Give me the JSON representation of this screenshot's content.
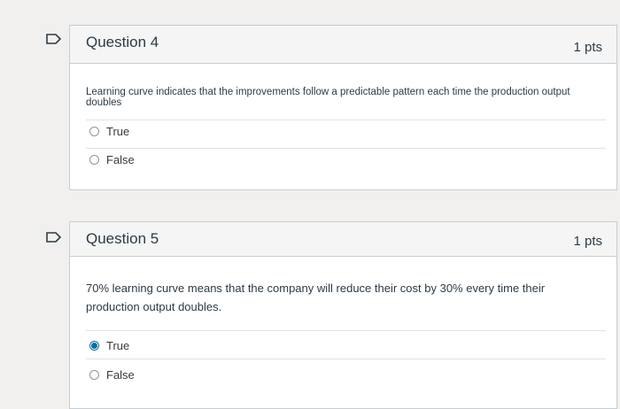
{
  "questions": [
    {
      "title": "Question 4",
      "points": "1 pts",
      "text": "Learning curve indicates that the improvements follow a predictable pattern each time the production output doubles",
      "answers": [
        {
          "label": "True",
          "selected": false
        },
        {
          "label": "False",
          "selected": false
        }
      ]
    },
    {
      "title": "Question 5",
      "points": "1 pts",
      "text": "70% learning curve means that the company will reduce their cost by 30% every time their production output doubles.",
      "answers": [
        {
          "label": "True",
          "selected": true
        },
        {
          "label": "False",
          "selected": false
        }
      ]
    }
  ],
  "colors": {
    "flag": "#2d3b45",
    "radio_selected": "#0770a3"
  },
  "icons": {
    "flag": "flag-icon"
  }
}
